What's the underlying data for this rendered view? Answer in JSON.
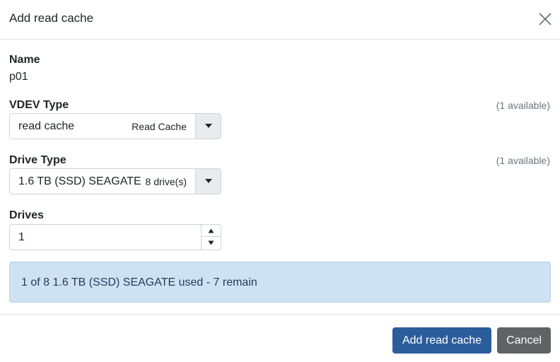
{
  "dialog": {
    "title": "Add read cache",
    "close_icon": "close-icon"
  },
  "name": {
    "label": "Name",
    "value": "p01"
  },
  "vdev_type": {
    "label": "VDEV Type",
    "available": "(1 available)",
    "selected": "read cache",
    "selected_detail": "Read Cache",
    "icon": "caret-down-icon"
  },
  "drive_type": {
    "label": "Drive Type",
    "available": "(1 available)",
    "selected": "1.6 TB (SSD) SEAGATE",
    "selected_detail": "8 drive(s)",
    "icon": "caret-down-icon"
  },
  "drives": {
    "label": "Drives",
    "value": "1"
  },
  "info": {
    "message": "1 of 8 1.6 TB (SSD) SEAGATE used - 7 remain"
  },
  "footer": {
    "submit_label": "Add read cache",
    "cancel_label": "Cancel"
  },
  "colors": {
    "primary": "#2c5d9b",
    "secondary": "#5f6366",
    "info_bg": "#cfe2f3"
  }
}
